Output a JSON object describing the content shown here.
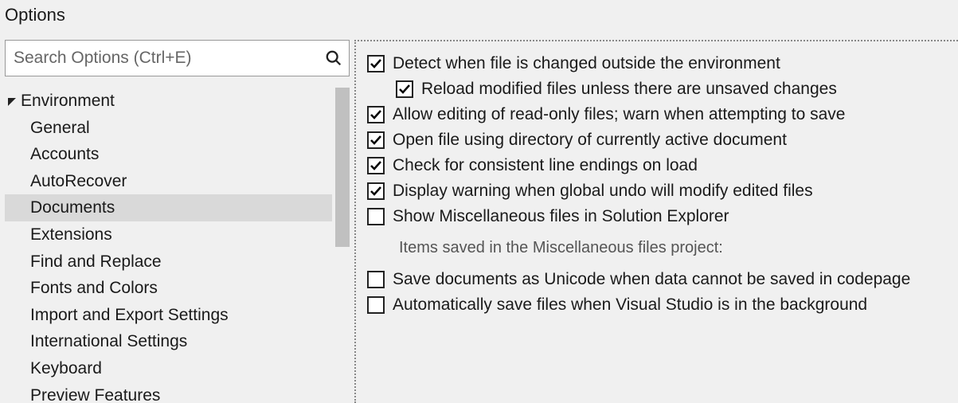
{
  "window": {
    "title": "Options"
  },
  "search": {
    "placeholder": "Search Options (Ctrl+E)"
  },
  "tree": {
    "category": "Environment",
    "items": [
      {
        "label": "General",
        "selected": false
      },
      {
        "label": "Accounts",
        "selected": false
      },
      {
        "label": "AutoRecover",
        "selected": false
      },
      {
        "label": "Documents",
        "selected": true
      },
      {
        "label": "Extensions",
        "selected": false
      },
      {
        "label": "Find and Replace",
        "selected": false
      },
      {
        "label": "Fonts and Colors",
        "selected": false
      },
      {
        "label": "Import and Export Settings",
        "selected": false
      },
      {
        "label": "International Settings",
        "selected": false
      },
      {
        "label": "Keyboard",
        "selected": false
      },
      {
        "label": "Preview Features",
        "selected": false
      }
    ]
  },
  "options": {
    "detect_change": {
      "label": "Detect when file is changed outside the environment",
      "checked": true
    },
    "reload_modified": {
      "label": "Reload modified files unless there are unsaved changes",
      "checked": true
    },
    "allow_readonly": {
      "label": "Allow editing of read-only files; warn when attempting to save",
      "checked": true
    },
    "open_using_dir": {
      "label": "Open file using directory of currently active document",
      "checked": true
    },
    "check_line_endings": {
      "label": "Check for consistent line endings on load",
      "checked": true
    },
    "global_undo_warn": {
      "label": "Display warning when global undo will modify edited files",
      "checked": true
    },
    "show_misc": {
      "label": "Show Miscellaneous files in Solution Explorer",
      "checked": false
    },
    "misc_sublabel": "Items saved in the Miscellaneous files project:",
    "save_unicode": {
      "label": "Save documents as Unicode when data cannot be saved in codepage",
      "checked": false
    },
    "autosave_bg": {
      "label": "Automatically save files when Visual Studio is in the background",
      "checked": false
    }
  }
}
